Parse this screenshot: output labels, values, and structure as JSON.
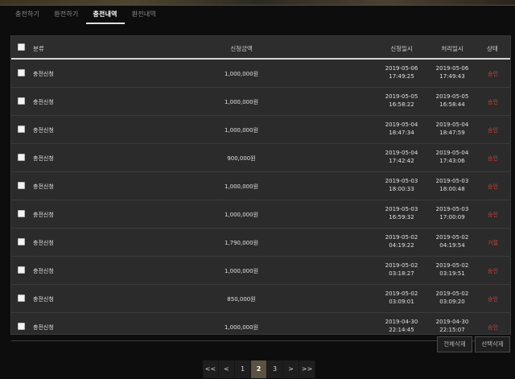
{
  "tabs": [
    {
      "label": "충전하기",
      "active": false
    },
    {
      "label": "환전하기",
      "active": false
    },
    {
      "label": "충전내역",
      "active": true
    },
    {
      "label": "환전내역",
      "active": false
    }
  ],
  "table": {
    "headers": {
      "type": "분류",
      "amount": "신청금액",
      "request_time": "신청일시",
      "process_time": "처리일시",
      "status": "상태"
    },
    "rows": [
      {
        "type": "충전신청",
        "amount": "1,000,000원",
        "req_date": "2019-05-06",
        "req_time": "17:49:25",
        "proc_date": "2019-05-06",
        "proc_time": "17:49:43",
        "status": "승인"
      },
      {
        "type": "충전신청",
        "amount": "1,000,000원",
        "req_date": "2019-05-05",
        "req_time": "16:58:22",
        "proc_date": "2019-05-05",
        "proc_time": "16:58:44",
        "status": "승인"
      },
      {
        "type": "충전신청",
        "amount": "1,000,000원",
        "req_date": "2019-05-04",
        "req_time": "18:47:34",
        "proc_date": "2019-05-04",
        "proc_time": "18:47:59",
        "status": "승인"
      },
      {
        "type": "충전신청",
        "amount": "900,000원",
        "req_date": "2019-05-04",
        "req_time": "17:42:42",
        "proc_date": "2019-05-04",
        "proc_time": "17:43:06",
        "status": "승인"
      },
      {
        "type": "충전신청",
        "amount": "1,000,000원",
        "req_date": "2019-05-03",
        "req_time": "18:00:33",
        "proc_date": "2019-05-03",
        "proc_time": "18:00:48",
        "status": "승인"
      },
      {
        "type": "충전신청",
        "amount": "1,000,000원",
        "req_date": "2019-05-03",
        "req_time": "16:59:32",
        "proc_date": "2019-05-03",
        "proc_time": "17:00:09",
        "status": "승인"
      },
      {
        "type": "충전신청",
        "amount": "1,790,000원",
        "req_date": "2019-05-02",
        "req_time": "04:19:22",
        "proc_date": "2019-05-02",
        "proc_time": "04:19:54",
        "status": "거절"
      },
      {
        "type": "충전신청",
        "amount": "1,000,000원",
        "req_date": "2019-05-02",
        "req_time": "03:18:27",
        "proc_date": "2019-05-02",
        "proc_time": "03:19:51",
        "status": "승인"
      },
      {
        "type": "충전신청",
        "amount": "850,000원",
        "req_date": "2019-05-02",
        "req_time": "03:09:01",
        "proc_date": "2019-05-02",
        "proc_time": "03:09:20",
        "status": "승인"
      },
      {
        "type": "충전신청",
        "amount": "1,000,000원",
        "req_date": "2019-04-30",
        "req_time": "22:14:45",
        "proc_date": "2019-04-30",
        "proc_time": "22:15:07",
        "status": "승인"
      }
    ]
  },
  "actions": {
    "delete_all": "전체삭제",
    "delete_selected": "선택삭제"
  },
  "pagination": {
    "first": "<<",
    "prev": "<",
    "pages": [
      "1",
      "2",
      "3"
    ],
    "current": "2",
    "next": ">",
    "last": ">>"
  },
  "colors": {
    "status": "#e23b2e",
    "accent_active_page": "#5c5243"
  }
}
